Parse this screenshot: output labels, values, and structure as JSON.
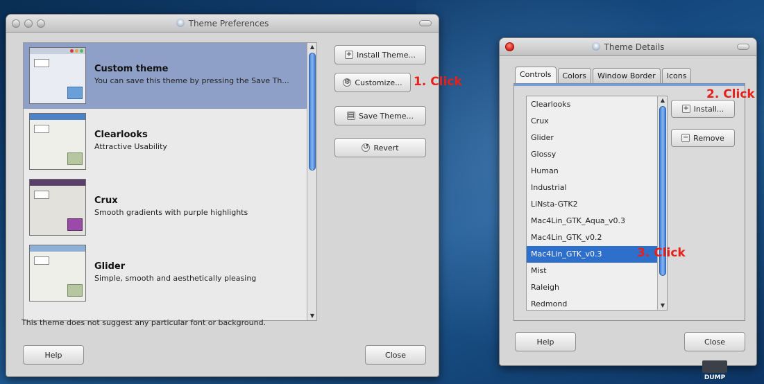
{
  "prefs_window": {
    "title": "Theme Preferences",
    "themes": [
      {
        "name": "Custom theme",
        "description": "You can save this theme by pressing the Save Th...",
        "selected": true
      },
      {
        "name": "Clearlooks",
        "description": "Attractive Usability",
        "selected": false
      },
      {
        "name": "Crux",
        "description": "Smooth gradients with purple highlights",
        "selected": false
      },
      {
        "name": "Glider",
        "description": "Simple, smooth and aesthetically pleasing",
        "selected": false
      }
    ],
    "buttons": {
      "install": "Install Theme...",
      "customize": "Customize...",
      "save": "Save Theme...",
      "revert": "Revert",
      "help": "Help",
      "close": "Close"
    },
    "hint": "This theme does not suggest any particular font or background."
  },
  "details_window": {
    "title": "Theme Details",
    "tabs": [
      "Controls",
      "Colors",
      "Window Border",
      "Icons"
    ],
    "active_tab": "Controls",
    "control_themes": [
      "Clearlooks",
      "Crux",
      "Glider",
      "Glossy",
      "Human",
      "Industrial",
      "LiNsta-GTK2",
      "Mac4Lin_GTK_Aqua_v0.3",
      "Mac4Lin_GTK_v0.2",
      "Mac4Lin_GTK_v0.3",
      "Mist",
      "Raleigh",
      "Redmond"
    ],
    "selected_control_theme": "Mac4Lin_GTK_v0.3",
    "buttons": {
      "install": "Install...",
      "remove": "Remove",
      "help": "Help",
      "close": "Close"
    }
  },
  "annotations": {
    "step1": "1. Click",
    "step2": "2. Click",
    "step3": "3. Click",
    "color": "#e8201a"
  },
  "desktop": {
    "dump_label": "DUMP"
  },
  "colors": {
    "selection_row": "#8ea0c8",
    "list_selection": "#2e6fcc",
    "scroll_thumb": "#3e7ed8"
  }
}
